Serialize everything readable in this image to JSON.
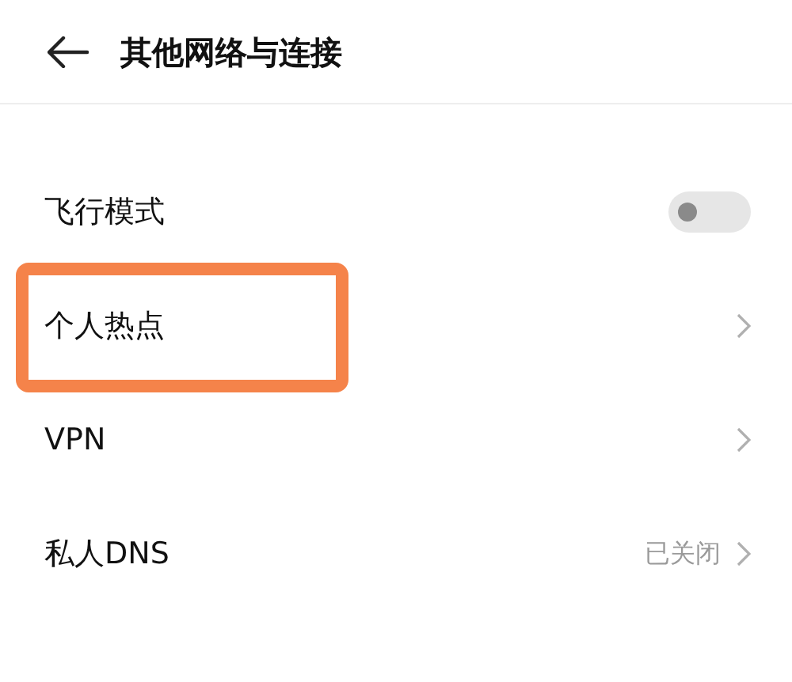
{
  "header": {
    "title": "其他网络与连接"
  },
  "items": [
    {
      "kind": "toggle",
      "label": "飞行模式",
      "on": false,
      "highlighted": false
    },
    {
      "kind": "link",
      "label": "个人热点",
      "highlighted": true
    },
    {
      "kind": "link",
      "label": "VPN",
      "highlighted": false
    },
    {
      "kind": "link",
      "label": "私人DNS",
      "value": "已关闭",
      "highlighted": false
    }
  ]
}
